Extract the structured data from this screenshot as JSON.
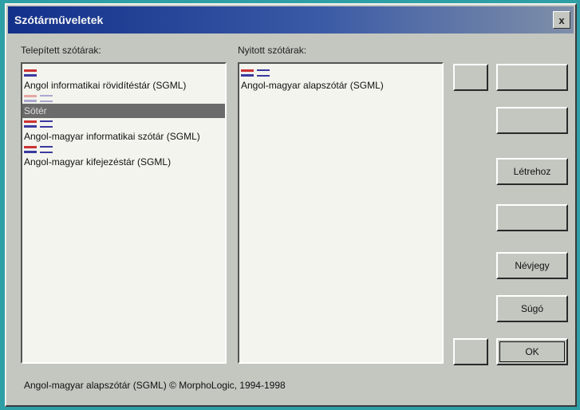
{
  "window": {
    "title": "Szótárműveletek",
    "close_label": "x"
  },
  "installed": {
    "label": "Telepített szótárak:",
    "items": [
      {
        "text": "Angol informatikai rövidítéstár (SGML)",
        "icon": "dictionary-flag-icon",
        "selected": false
      },
      {
        "text": "Sötér",
        "icon": "dictionary-flag-icon",
        "selected": true
      },
      {
        "text": "Angol-magyar informatikai szótár (SGML)",
        "icon": "dictionary-flag-icon",
        "selected": false
      },
      {
        "text": "Angol-magyar kifejezéstár (SGML)",
        "icon": "dictionary-flag-icon",
        "selected": false
      }
    ]
  },
  "opened": {
    "label": "Nyitott szótárak:",
    "items": [
      {
        "text": "Angol-magyar alapszótár (SGML)",
        "icon": "dictionary-flag-icon"
      }
    ]
  },
  "buttons": {
    "create": "Létrehoz",
    "about": "Névjegy",
    "help": "Súgó",
    "ok": "OK"
  },
  "status": "Angol-magyar alapszótár (SGML) © MorphoLogic, 1994-1998"
}
